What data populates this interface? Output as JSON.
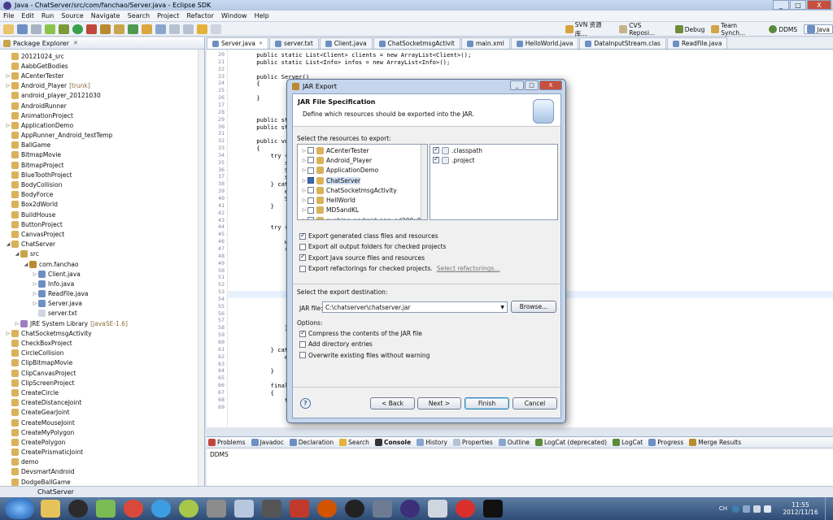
{
  "window": {
    "title": "Java - ChatServer/src/com/fanchao/Server.java - Eclipse SDK",
    "controls": [
      "_",
      "□",
      "X"
    ]
  },
  "menu": [
    "File",
    "Edit",
    "Run",
    "Source",
    "Navigate",
    "Search",
    "Project",
    "Refactor",
    "Window",
    "Help"
  ],
  "perspectives": [
    "SVN 资源库...",
    "CVS Reposi...",
    "Debug",
    "Team Synch...",
    "DDMS",
    "Java"
  ],
  "package_explorer": {
    "title": "Package Explorer",
    "items": [
      {
        "label": "20121024_src",
        "indent": 0,
        "twisty": ""
      },
      {
        "label": "AabbGetBodies",
        "indent": 0,
        "twisty": ""
      },
      {
        "label": "ACenterTester",
        "indent": 0,
        "twisty": "▷"
      },
      {
        "label": "Android_Player",
        "extra": "[trunk]",
        "indent": 0,
        "twisty": "▷"
      },
      {
        "label": "android_player_20121030",
        "indent": 0,
        "twisty": ""
      },
      {
        "label": "AndroidRunner",
        "indent": 0,
        "twisty": ""
      },
      {
        "label": "AnimationProject",
        "indent": 0,
        "twisty": ""
      },
      {
        "label": "ApplicationDemo",
        "indent": 0,
        "twisty": "▷"
      },
      {
        "label": "AppRunner_Android_testTemp",
        "indent": 0,
        "twisty": ""
      },
      {
        "label": "BallGame",
        "indent": 0,
        "twisty": ""
      },
      {
        "label": "BitmapMovie",
        "indent": 0,
        "twisty": ""
      },
      {
        "label": "BitmapProject",
        "indent": 0,
        "twisty": ""
      },
      {
        "label": "BlueToothProject",
        "indent": 0,
        "twisty": ""
      },
      {
        "label": "BodyCollision",
        "indent": 0,
        "twisty": ""
      },
      {
        "label": "BodyForce",
        "indent": 0,
        "twisty": ""
      },
      {
        "label": "Box2dWorld",
        "indent": 0,
        "twisty": ""
      },
      {
        "label": "BuildHouse",
        "indent": 0,
        "twisty": ""
      },
      {
        "label": "ButtonProject",
        "indent": 0,
        "twisty": ""
      },
      {
        "label": "CanvasProject",
        "indent": 0,
        "twisty": ""
      },
      {
        "label": "ChatServer",
        "indent": 0,
        "twisty": "◢"
      },
      {
        "label": "src",
        "indent": 1,
        "twisty": "◢"
      },
      {
        "label": "com.fanchao",
        "indent": 2,
        "twisty": "◢"
      },
      {
        "label": "Client.java",
        "indent": 3,
        "twisty": "▷"
      },
      {
        "label": "Info.java",
        "indent": 3,
        "twisty": "▷"
      },
      {
        "label": "ReadFile.java",
        "indent": 3,
        "twisty": "▷"
      },
      {
        "label": "Server.java",
        "indent": 3,
        "twisty": "▷"
      },
      {
        "label": "server.txt",
        "indent": 3,
        "twisty": ""
      },
      {
        "label": "JRE System Library",
        "extra": "[JavaSE-1.6]",
        "indent": 1,
        "twisty": "▷"
      },
      {
        "label": "ChatSocketmsgActivity",
        "indent": 0,
        "twisty": "▷"
      },
      {
        "label": "CheckBoxProject",
        "indent": 0,
        "twisty": ""
      },
      {
        "label": "CircleCollision",
        "indent": 0,
        "twisty": ""
      },
      {
        "label": "ClipBitmapMovie",
        "indent": 0,
        "twisty": ""
      },
      {
        "label": "ClipCanvasProject",
        "indent": 0,
        "twisty": ""
      },
      {
        "label": "ClipScreenProject",
        "indent": 0,
        "twisty": ""
      },
      {
        "label": "CreateCircle",
        "indent": 0,
        "twisty": ""
      },
      {
        "label": "CreateDistanceJoint",
        "indent": 0,
        "twisty": ""
      },
      {
        "label": "CreateGearJoint",
        "indent": 0,
        "twisty": ""
      },
      {
        "label": "CreateMouseJoint",
        "indent": 0,
        "twisty": ""
      },
      {
        "label": "CreateMyPolygon",
        "indent": 0,
        "twisty": ""
      },
      {
        "label": "CreatePolygon",
        "indent": 0,
        "twisty": ""
      },
      {
        "label": "CreatePrismaticJoint",
        "indent": 0,
        "twisty": ""
      },
      {
        "label": "demo",
        "indent": 0,
        "twisty": ""
      },
      {
        "label": "DevsmartAndroid",
        "indent": 0,
        "twisty": ""
      },
      {
        "label": "DodgeBallGame",
        "indent": 0,
        "twisty": ""
      }
    ]
  },
  "editor_tabs": [
    {
      "label": "Server.java",
      "active": true
    },
    {
      "label": "server.txt",
      "active": false
    },
    {
      "label": "Client.java",
      "active": false
    },
    {
      "label": "ChatSocketmsgActivit",
      "active": false
    },
    {
      "label": "main.xml",
      "active": false
    },
    {
      "label": "HelloWorld.java",
      "active": false
    },
    {
      "label": "DataInputStream.clas",
      "active": false
    },
    {
      "label": "ReadFile.java",
      "active": false
    }
  ],
  "code_lines": [
    {
      "n": "20",
      "t": "    public static List<Client> clients = new ArrayList<Client>();"
    },
    {
      "n": "21",
      "t": "    public static List<Info> infos = new ArrayList<Info>();"
    },
    {
      "n": "22",
      "t": ""
    },
    {
      "n": "23",
      "t": "    public Server()"
    },
    {
      "n": "24",
      "t": "    {"
    },
    {
      "n": "25",
      "t": ""
    },
    {
      "n": "26",
      "t": "    }"
    },
    {
      "n": "27",
      "t": ""
    },
    {
      "n": "28",
      "t": ""
    },
    {
      "n": "29",
      "t": "    public static"
    },
    {
      "n": "30",
      "t": "    public static"
    },
    {
      "n": "31",
      "t": ""
    },
    {
      "n": "32",
      "t": "    public void s"
    },
    {
      "n": "33",
      "t": "    {"
    },
    {
      "n": "34",
      "t": "        try {"
    },
    {
      "n": "35",
      "t": "            ss ="
    },
    {
      "n": "36",
      "t": "            Syste"
    },
    {
      "n": "37",
      "t": "            start"
    },
    {
      "n": "38",
      "t": "        } catch ("
    },
    {
      "n": "39",
      "t": "            e.pri"
    },
    {
      "n": "40",
      "t": "            Syste"
    },
    {
      "n": "41",
      "t": "        }"
    },
    {
      "n": "42",
      "t": ""
    },
    {
      "n": "43",
      "t": ""
    },
    {
      "n": "44",
      "t": "        try {"
    },
    {
      "n": "45",
      "t": ""
    },
    {
      "n": "46",
      "t": "            w"
    },
    {
      "n": "47",
      "t": "            {"
    },
    {
      "n": "48",
      "t": ""
    },
    {
      "n": "49",
      "t": ""
    },
    {
      "n": "50",
      "t": ""
    },
    {
      "n": "51",
      "t": ""
    },
    {
      "n": "52",
      "t": ""
    },
    {
      "n": "53",
      "t": ""
    },
    {
      "n": "54",
      "t": ""
    },
    {
      "n": "55",
      "t": ""
    },
    {
      "n": "56",
      "t": ""
    },
    {
      "n": "57",
      "t": ""
    },
    {
      "n": "58",
      "t": "            }"
    },
    {
      "n": "59",
      "t": ""
    },
    {
      "n": "60",
      "t": ""
    },
    {
      "n": "61",
      "t": "        } cat"
    },
    {
      "n": "62",
      "t": "            e"
    },
    {
      "n": "63",
      "t": ""
    },
    {
      "n": "64",
      "t": "        }"
    },
    {
      "n": "65",
      "t": ""
    },
    {
      "n": "66",
      "t": "        final"
    },
    {
      "n": "67",
      "t": "        {"
    },
    {
      "n": "68",
      "t": "            t"
    },
    {
      "n": "69",
      "t": ""
    }
  ],
  "dialog": {
    "title": "JAR Export",
    "heading": "JAR File Specification",
    "description": "Define which resources should be exported into the JAR.",
    "resources_label": "Select the resources to export:",
    "projects": [
      {
        "label": "ACenterTester",
        "state": "off"
      },
      {
        "label": "Android_Player",
        "state": "off"
      },
      {
        "label": "ApplicationDemo",
        "state": "off"
      },
      {
        "label": "ChatServer",
        "state": "part"
      },
      {
        "label": "ChatSocketmsgActivity",
        "state": "off"
      },
      {
        "label": "HellWorld",
        "state": "off"
      },
      {
        "label": "MD5andKL",
        "state": "off"
      },
      {
        "label": "pushing_android_app_ed200x0",
        "state": "off"
      }
    ],
    "files": [
      {
        "label": ".classpath",
        "state": "on"
      },
      {
        "label": ".project",
        "state": "on"
      }
    ],
    "export_options": [
      {
        "label": "Export generated class files and resources",
        "state": "on"
      },
      {
        "label": "Export all output folders for checked projects",
        "state": "off"
      },
      {
        "label": "Export Java source files and resources",
        "state": "on"
      },
      {
        "label": "Export refactorings for checked projects.",
        "state": "off",
        "link": "Select refactorings..."
      }
    ],
    "destination_label": "Select the export destination:",
    "jar_file_label": "JAR file:",
    "jar_file_value": "C:\\chatserver\\chatserver.jar",
    "browse_label": "Browse...",
    "options_label": "Options:",
    "options": [
      {
        "label": "Compress the contents of the JAR file",
        "state": "on"
      },
      {
        "label": "Add directory entries",
        "state": "off"
      },
      {
        "label": "Overwrite existing files without warning",
        "state": "off"
      }
    ],
    "buttons": {
      "back": "< Back",
      "next": "Next >",
      "finish": "Finish",
      "cancel": "Cancel"
    },
    "help": "?"
  },
  "console_tabs": [
    "Problems",
    "Javadoc",
    "Declaration",
    "Search",
    "Console",
    "History",
    "Properties",
    "Outline",
    "LogCat (deprecated)",
    "LogCat",
    "Progress",
    "Merge Results"
  ],
  "console_text": "DDMS",
  "status_text": "ChatServer",
  "taskbar": {
    "time": "11:55",
    "date": "2012/11/16",
    "lang": "CH"
  },
  "colors": {
    "accent": "#3c7fb1",
    "dialog_frame": "#c5d6ec",
    "titlebar": "#c9daf0"
  }
}
